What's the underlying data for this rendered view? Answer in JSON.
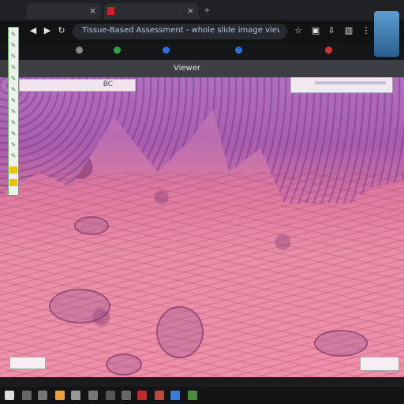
{
  "browser": {
    "tab1": {
      "label": ""
    },
    "tab2": {
      "label": ""
    },
    "url": "Tissue-Based Assessment - whole slide image viewer"
  },
  "bookmarks": [
    {
      "label": ""
    },
    {
      "label": ""
    },
    {
      "label": ""
    },
    {
      "label": ""
    },
    {
      "label": ""
    }
  ],
  "viewer": {
    "title": "Viewer"
  },
  "slide": {
    "label_left": "BC"
  },
  "colors": {
    "epithelium": "#b06fc0",
    "stroma": "#e98fa8",
    "toolbar_bg": "#111214"
  }
}
